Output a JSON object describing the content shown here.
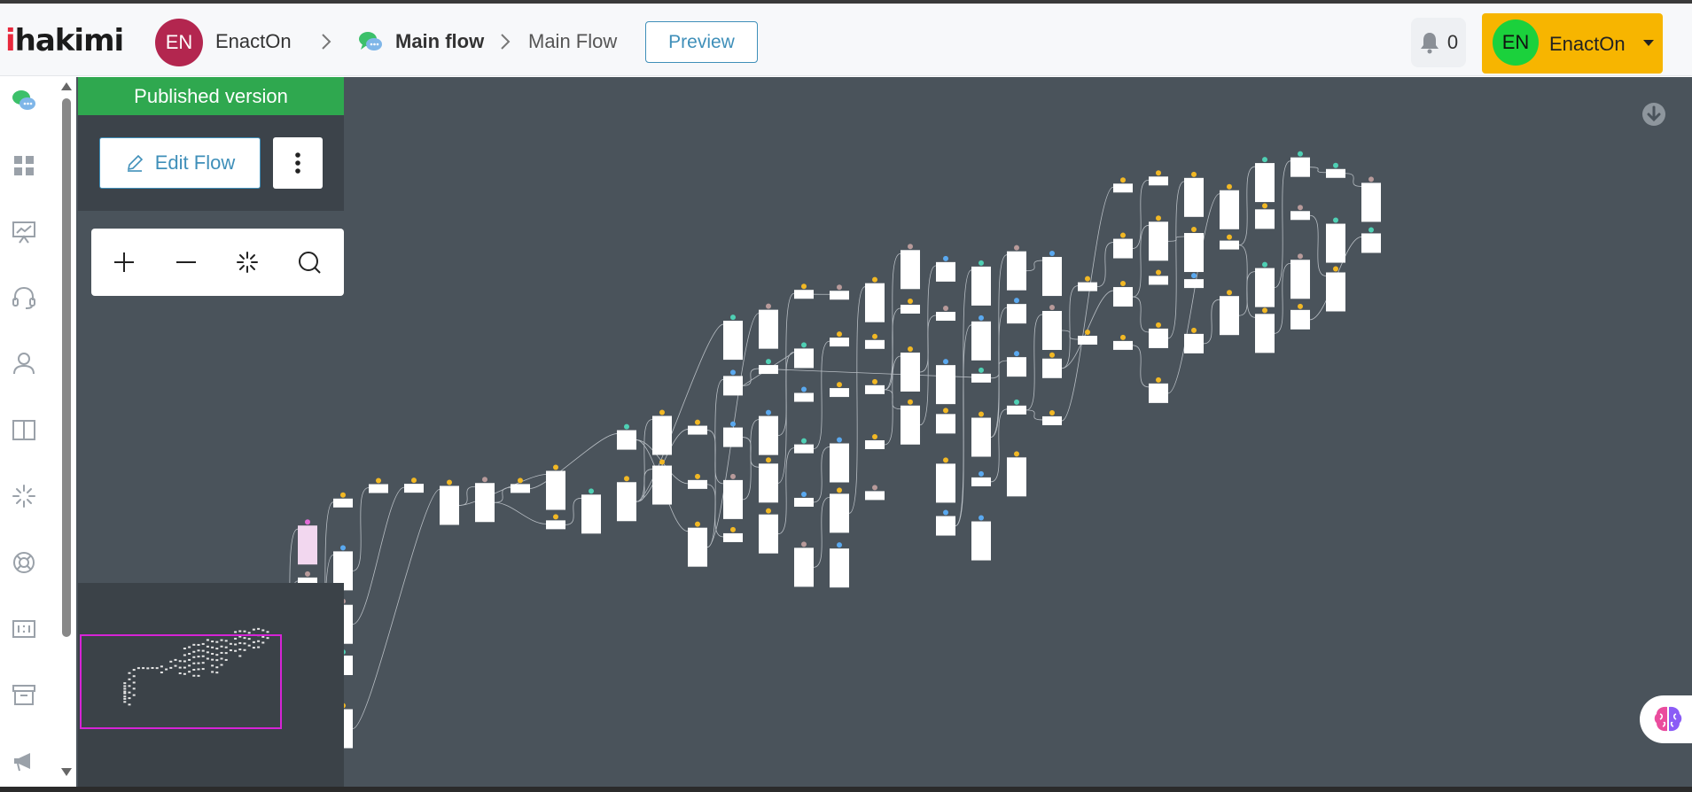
{
  "app": {
    "logo_i": "i",
    "logo_rest": "hakimi"
  },
  "header": {
    "workspace_initials": "EN",
    "workspace_name": "EnactOn",
    "breadcrumb_flow": "Main flow",
    "breadcrumb_page": "Main Flow",
    "preview_label": "Preview",
    "notification_count": "0",
    "user_initials": "EN",
    "user_name": "EnactOn"
  },
  "sidebar": {
    "items": [
      {
        "icon": "chat-bubbles-icon",
        "active": true
      },
      {
        "icon": "dashboard-grid-icon"
      },
      {
        "icon": "presentation-chart-icon"
      },
      {
        "icon": "headset-icon"
      },
      {
        "icon": "user-icon"
      },
      {
        "icon": "book-icon"
      },
      {
        "icon": "sparkle-icon"
      },
      {
        "icon": "lifebuoy-icon"
      },
      {
        "icon": "ratio-icon"
      },
      {
        "icon": "archive-icon"
      },
      {
        "icon": "megaphone-icon"
      }
    ]
  },
  "flow_panel": {
    "status_label": "Published version",
    "edit_label": "Edit Flow"
  },
  "colors": {
    "brand_red": "#e8283c",
    "workspace_avatar": "#b3264f",
    "accent_blue": "#3f8fb9",
    "published_green": "#2fa84f",
    "user_button": "#f7b500",
    "user_avatar": "#1bd13c",
    "canvas_bg": "#4a535b",
    "minimap_frame": "#d624d6",
    "node_dot_yellow": "#f2b824",
    "node_dot_teal": "#4fd0b4",
    "node_dot_blue": "#5aa9f0",
    "node_dot_pink": "#e26bd6"
  }
}
